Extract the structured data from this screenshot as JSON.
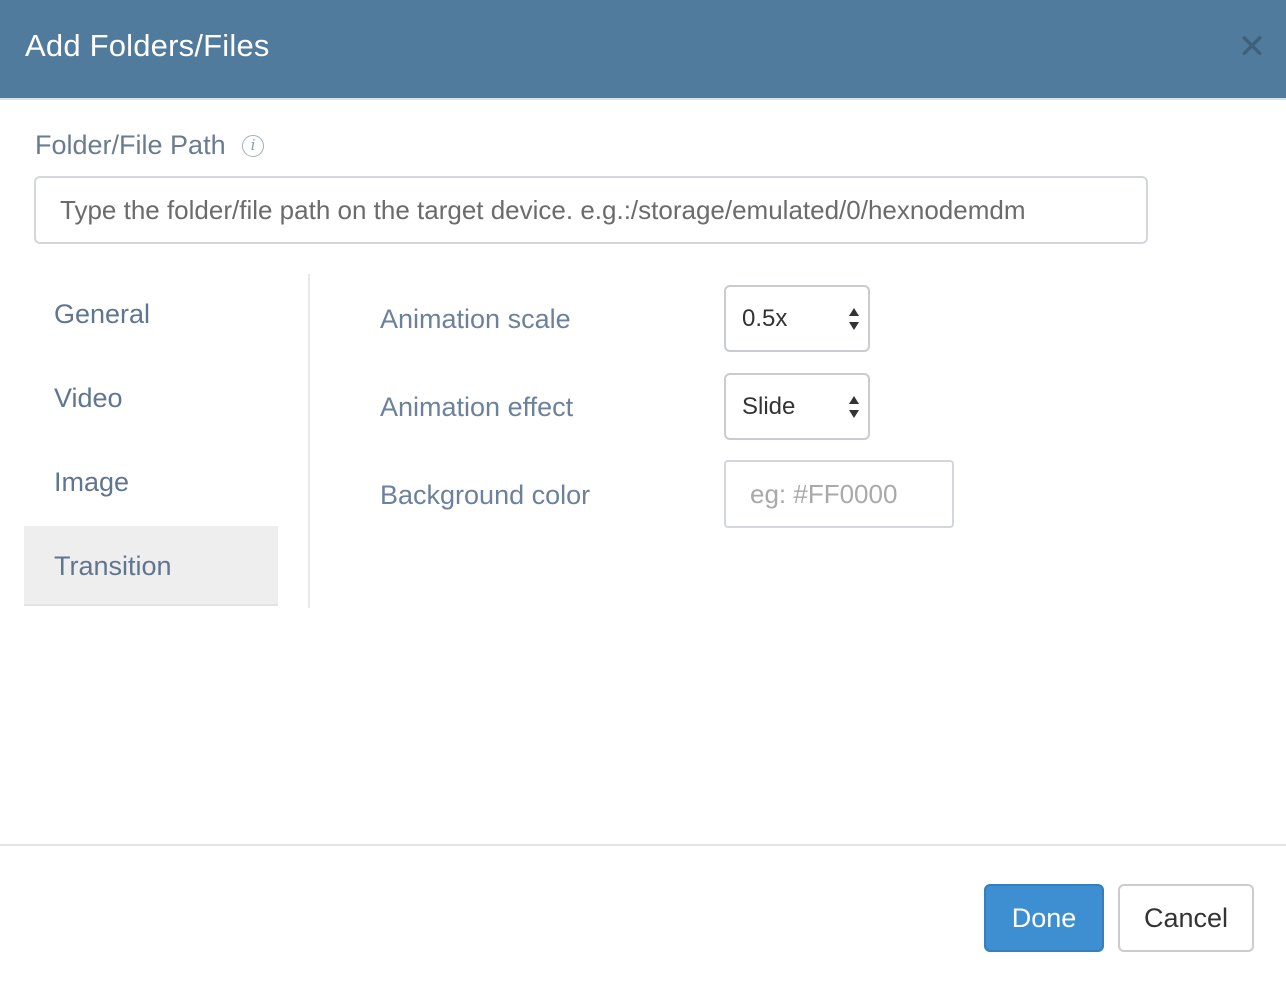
{
  "dialog": {
    "title": "Add Folders/Files",
    "close_icon": "close-icon"
  },
  "path": {
    "label": "Folder/File Path",
    "info_icon": "info-icon",
    "info_glyph": "i",
    "placeholder": "Type the folder/file path on the target device. e.g.:/storage/emulated/0/hexnodemdm",
    "value": ""
  },
  "nav": {
    "items": [
      {
        "label": "General",
        "active": false
      },
      {
        "label": "Video",
        "active": false
      },
      {
        "label": "Image",
        "active": false
      },
      {
        "label": "Transition",
        "active": true
      }
    ]
  },
  "fields": {
    "animation_scale": {
      "label": "Animation scale",
      "value": "0.5x"
    },
    "animation_effect": {
      "label": "Animation effect",
      "value": "Slide"
    },
    "background_color": {
      "label": "Background color",
      "placeholder": "eg: #FF0000",
      "value": ""
    }
  },
  "footer": {
    "done_label": "Done",
    "cancel_label": "Cancel"
  },
  "colors": {
    "header_bg": "#517b9c",
    "primary_button": "#3d8fd1",
    "active_nav_bg": "#eeeeee"
  }
}
